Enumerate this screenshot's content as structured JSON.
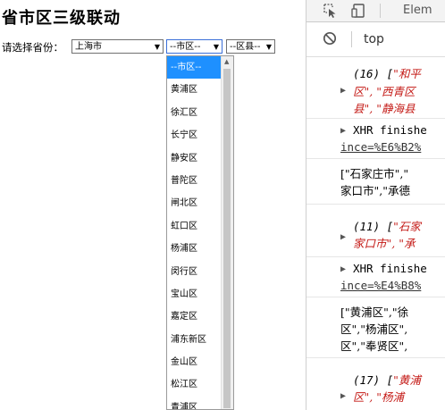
{
  "page": {
    "title": "省市区三级联动",
    "province_label": "请选择省份：",
    "province_select": {
      "value": "上海市"
    },
    "city_select": {
      "value": "--市区--"
    },
    "county_select": {
      "value": "--区县--"
    },
    "city_options": [
      "--市区--",
      "黄浦区",
      "徐汇区",
      "长宁区",
      "静安区",
      "普陀区",
      "闸北区",
      "虹口区",
      "杨浦区",
      "闵行区",
      "宝山区",
      "嘉定区",
      "浦东新区",
      "金山区",
      "松江区",
      "青浦区"
    ],
    "selected_option_index": 0
  },
  "devtools": {
    "tab_elements": "Elem",
    "context": "top",
    "console": {
      "msg1_line1_prefix": "(16) [",
      "msg1_line1_red": "\"和平",
      "msg1_line2_red": "区\", \"西青区",
      "msg1_line3_red": "县\", \"静海县",
      "msg2_line1": "XHR finishe",
      "msg2_line2": "ince=%E6%B2%",
      "msg3_line1": "[\"石家庄市\",\"",
      "msg3_line2": "家口市\",\"承德",
      "msg4_line1_prefix": "(11) [",
      "msg4_line1_red": "\"石家",
      "msg4_line2_red": "家口市\", \"承",
      "msg5_line1": "XHR finishe",
      "msg5_line2": "ince=%E4%B8%",
      "msg6_line1": "[\"黄浦区\",\"徐",
      "msg6_line2": "区\",\"杨浦区\",",
      "msg6_line3": "区\",\"奉贤区\",",
      "msg7_line1_prefix": "(17) [",
      "msg7_line1_red": "\"黄浦",
      "msg7_line2_red": "区\", \"杨浦"
    }
  }
}
